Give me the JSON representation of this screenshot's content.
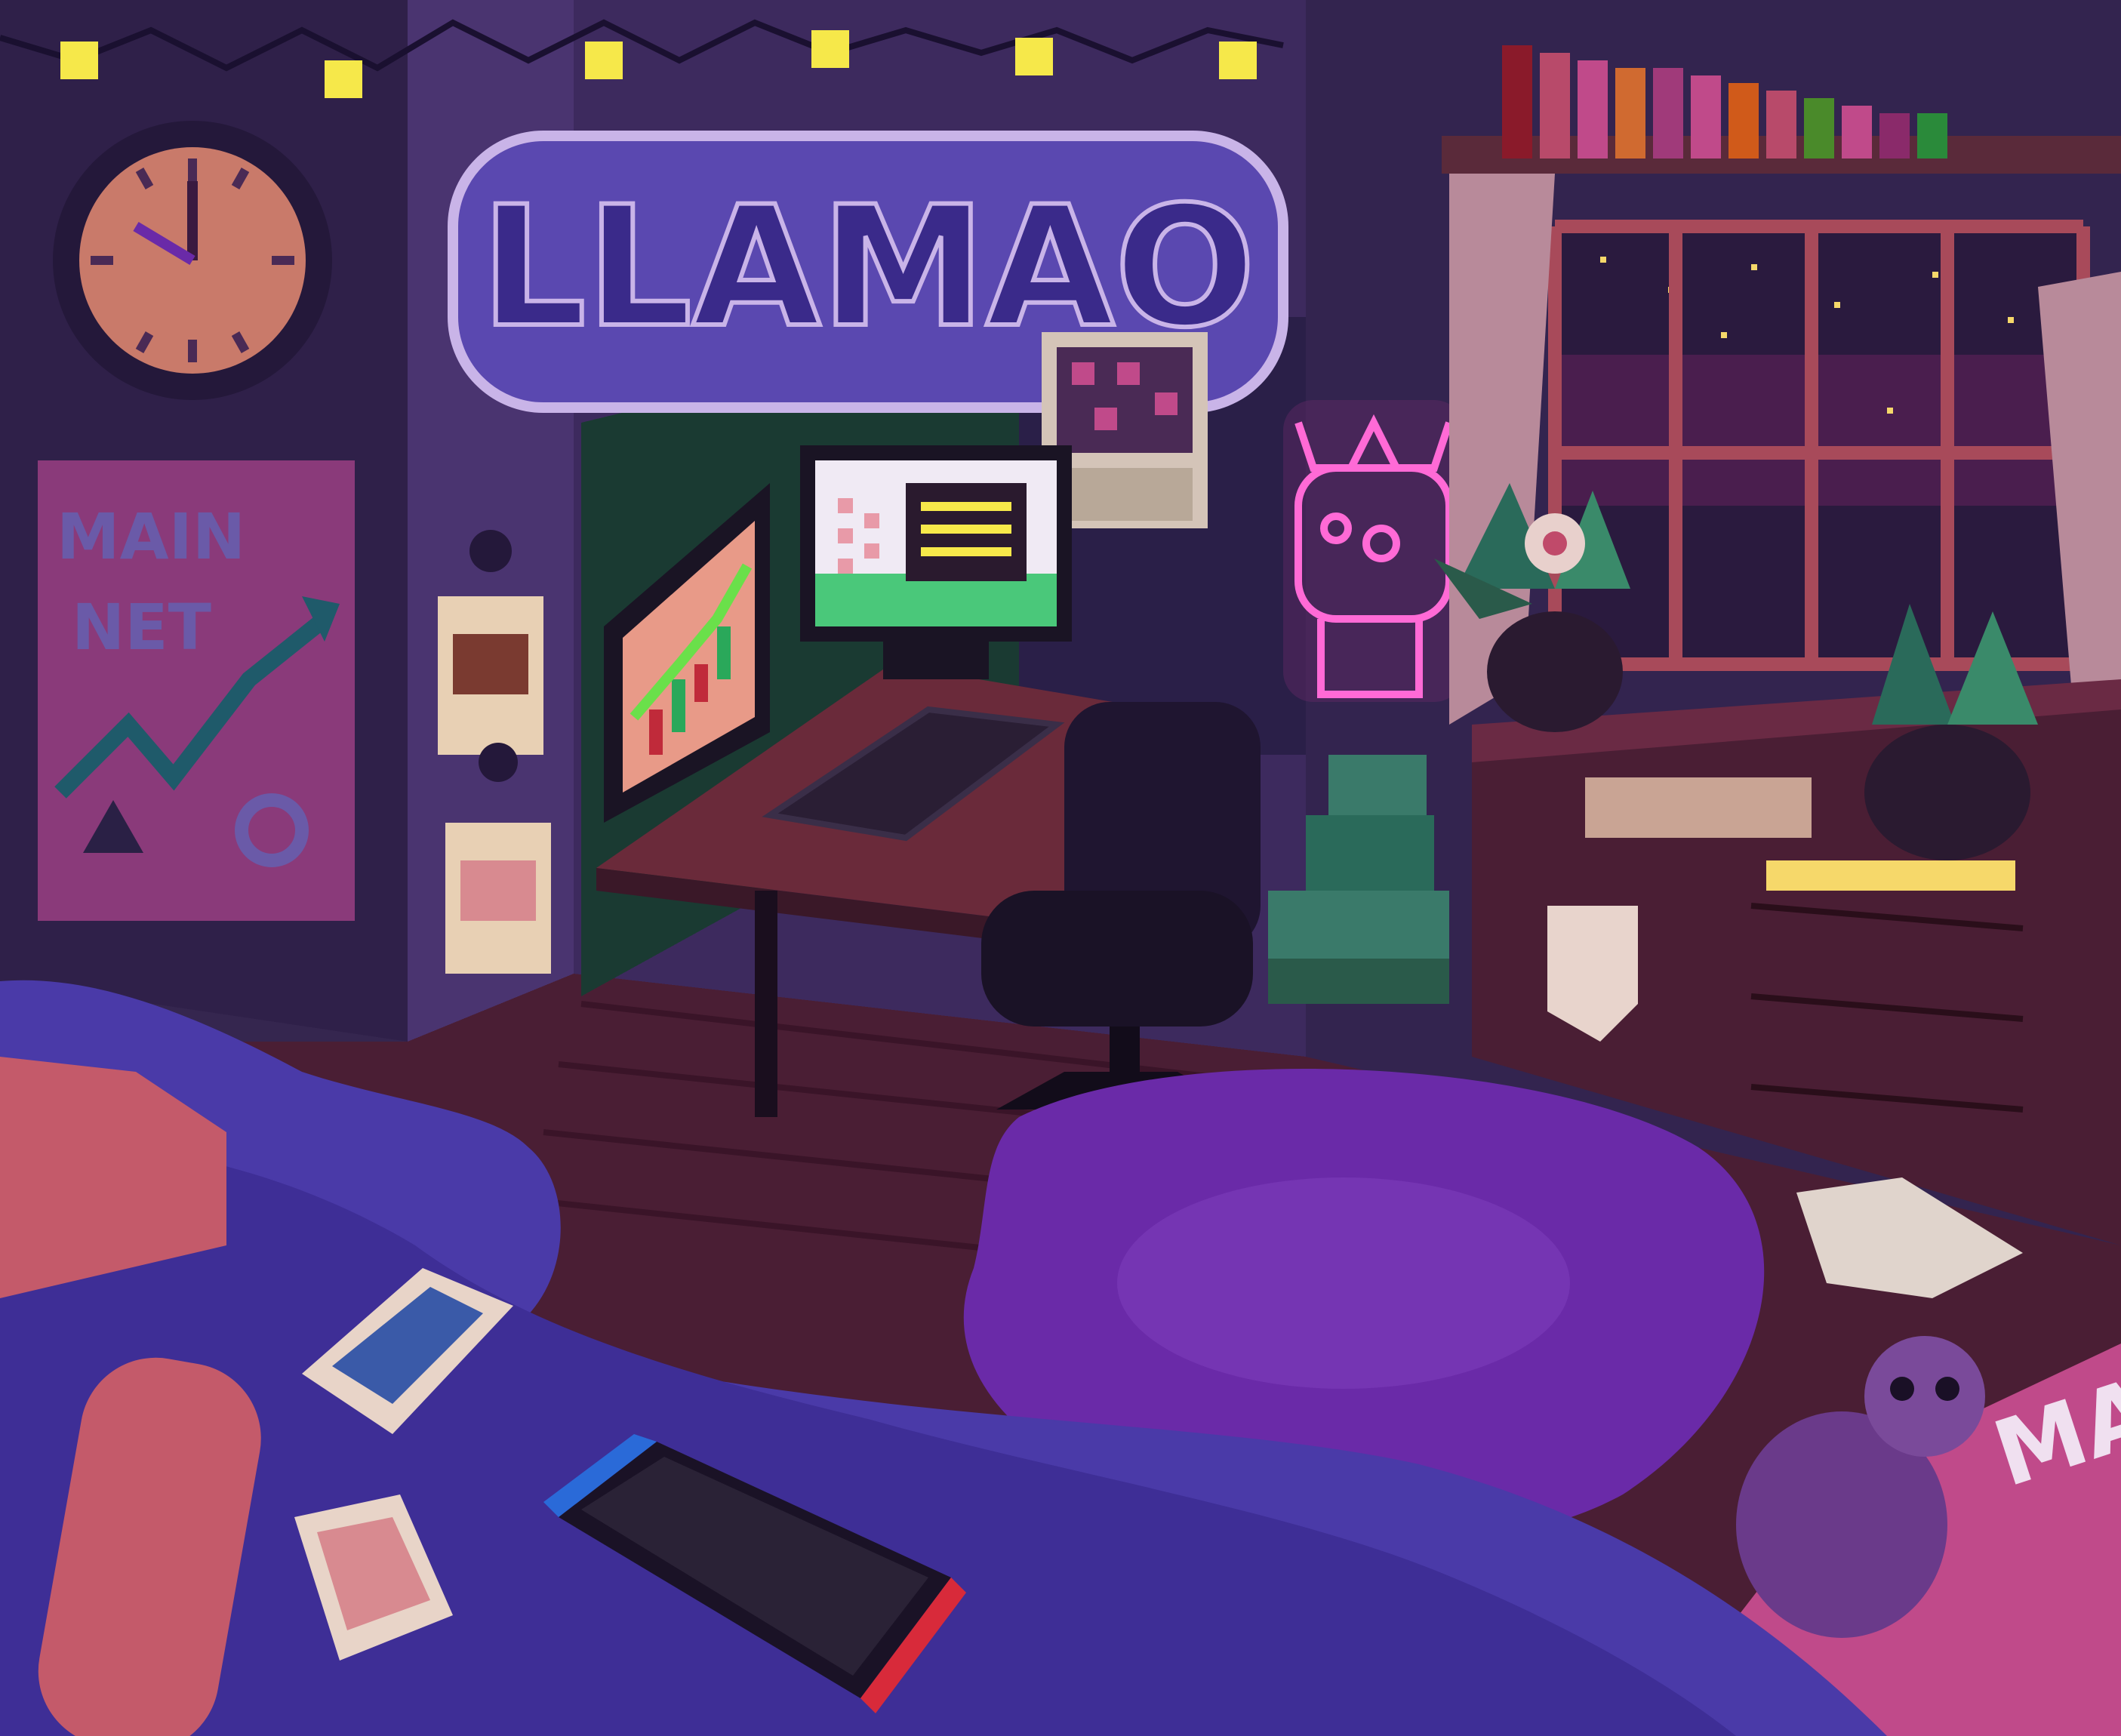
{
  "scene": {
    "description_tag": "pixel-art-bedroom",
    "colors": {
      "wall": "#3d2a5e",
      "wall_dark": "#2f2049",
      "floor": "#4a1e34",
      "bed": "#4a3aa8",
      "rug": "#6a2aa8",
      "neon": "#ff6ad6",
      "string_light": "#f6e84a"
    }
  },
  "wall_sign": {
    "text": "LLAMAO"
  },
  "poster": {
    "line1": "MAIN",
    "line2": "NET"
  },
  "clock": {
    "icon": "wall-clock-icon"
  },
  "mat": {
    "text": "MAIN"
  },
  "monitor_right": {
    "icon": "dialog-window-icon"
  },
  "monitor_left": {
    "icon": "candlestick-chart-icon"
  },
  "handheld_console": {
    "icon": "game-console-icon"
  },
  "plush": {
    "icon": "llama-plush-icon"
  }
}
